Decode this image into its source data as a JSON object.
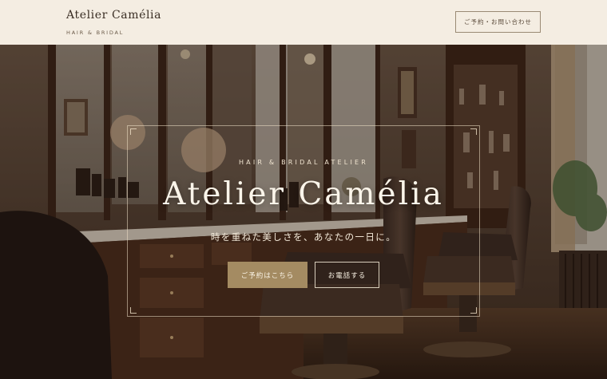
{
  "header": {
    "brand_title": "Atelier Camélia",
    "brand_subtitle": "HAIR & BRIDAL",
    "contact_button": "ご予約・お問い合わせ"
  },
  "hero": {
    "eyebrow": "HAIR & BRIDAL ATELIER",
    "title": "Atelier Camélia",
    "tagline": "時を重ねた美しさを、あなたの一日に。",
    "primary_button": "ご予約はこちら",
    "secondary_button": "お電話する"
  },
  "colors": {
    "header_bg": "#f4ede2",
    "accent_gold": "#a48b62",
    "text_dark": "#3a2e24",
    "hero_text": "#fbf5ea"
  }
}
